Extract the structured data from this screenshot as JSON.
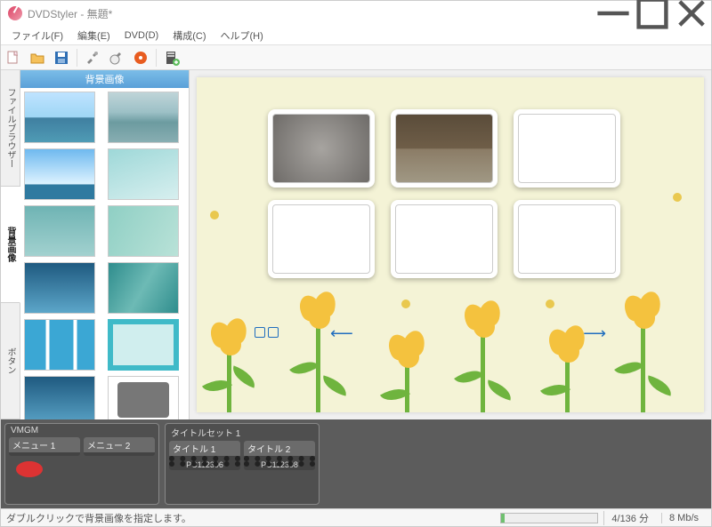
{
  "titlebar": {
    "title": "DVDStyler - 無題*"
  },
  "menubar": {
    "file": "ファイル(F)",
    "edit": "編集(E)",
    "dvd": "DVD(D)",
    "config": "構成(C)",
    "help": "ヘルプ(H)"
  },
  "sidetabs": {
    "filebrowser": "ファイルブラウザー",
    "backgrounds": "背景画像",
    "buttons": "ボタン"
  },
  "bgpanel": {
    "header": "背景画像"
  },
  "timeline": {
    "group1": "VMGM",
    "menu1": "メニュー 1",
    "menu2": "メニュー 2",
    "group2": "タイトルセット 1",
    "title1": "タイトル 1",
    "title2": "タイトル 2",
    "footer1": "PC112306",
    "footer2": "PC112308"
  },
  "statusbar": {
    "hint": "ダブルクリックで背景画像を指定します。",
    "progress_text": "4/136 分",
    "bitrate": "8 Mb/s"
  }
}
